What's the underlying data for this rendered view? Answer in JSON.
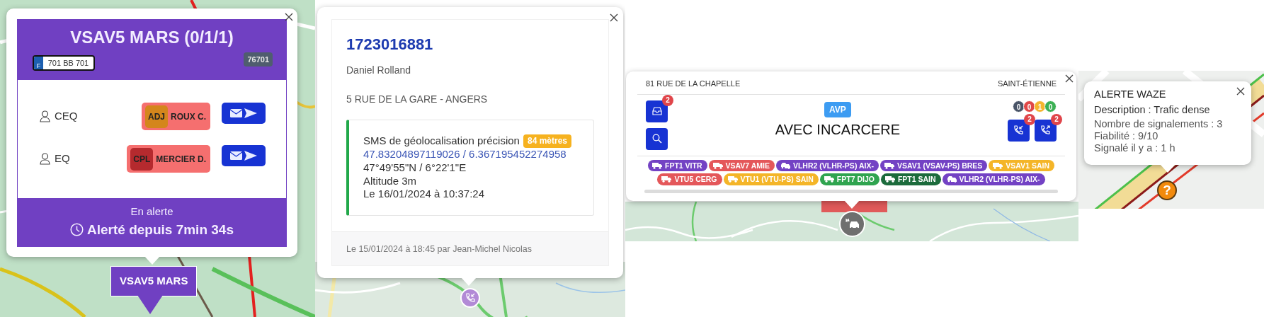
{
  "vehicle_popup": {
    "title": "VSAV5 MARS (0/1/1)",
    "plate_country": "F",
    "plate": "701 BB 701",
    "code": "76701",
    "crew": [
      {
        "role": "CEQ",
        "grade": "ADJ",
        "color": "#d4861c",
        "name": "ROUX C."
      },
      {
        "role": "EQ",
        "grade": "CPL",
        "color": "#b52a2e",
        "name": "MERCIER D."
      }
    ],
    "status": "En alerte",
    "alert_time": "Alerté depuis 7min 34s",
    "marker_label": "VSAV5 MARS"
  },
  "caller_popup": {
    "phone": "1723016881",
    "name": "Daniel Rolland",
    "address": "5 RUE DE LA GARE - ANGERS",
    "geoloc": {
      "label": "SMS de géolocalisation précision",
      "precision": "84 mètres",
      "decimal": "47.83204897119026 / 6.367195452274958",
      "dms": "47°49'55\"N / 6°22'1\"E",
      "altitude": "Altitude 3m",
      "date": "Le 16/01/2024 à 10:37:24"
    },
    "footer": "Le 15/01/2024 à 18:45 par Jean-Michel Nicolas"
  },
  "incident_popup": {
    "address": "81 RUE DE LA CHAPELLE",
    "city": "SAINT-ÉTIENNE",
    "left_buttons": [
      {
        "kind": "inbox",
        "badge": "2"
      },
      {
        "kind": "search"
      }
    ],
    "code": "AVP",
    "title": "AVEC INCARCERE",
    "counters": [
      {
        "value": "0",
        "color": "#4a5568"
      },
      {
        "value": "0",
        "color": "#e04848"
      },
      {
        "value": "1",
        "color": "#f5b52e"
      },
      {
        "value": "0",
        "color": "#3cb054"
      }
    ],
    "call_buttons": [
      {
        "kind": "incoming",
        "badge": "2"
      },
      {
        "kind": "outgoing",
        "badge": "2"
      }
    ],
    "units": [
      {
        "label": "FPT1 VITR",
        "kind": "truck",
        "color": "#7342c4"
      },
      {
        "label": "VSAV7 AMIE",
        "kind": "truck",
        "color": "#e4575a"
      },
      {
        "label": "VLHR2 (VLHR-PS) AIX-",
        "kind": "car",
        "color": "#7342c4"
      },
      {
        "label": "VSAV1 (VSAV-PS) BRES",
        "kind": "truck",
        "color": "#7342c4"
      },
      {
        "label": "VSAV1 SAIN",
        "kind": "truck",
        "color": "#f4b528"
      },
      {
        "label": "VTU5 CERG",
        "kind": "truck",
        "color": "#e4575a"
      },
      {
        "label": "VTU1 (VTU-PS) SAIN",
        "kind": "truck",
        "color": "#f4b528"
      },
      {
        "label": "FPT7 DIJO",
        "kind": "truck",
        "color": "#2fa44f"
      },
      {
        "label": "FPT1 SAIN",
        "kind": "truck",
        "color": "#1c6b3c"
      },
      {
        "label": "VLHR2 (VLHR-PS) AIX-",
        "kind": "car",
        "color": "#7342c4"
      }
    ]
  },
  "waze_popup": {
    "title": "ALERTE WAZE",
    "description": "Description : Trafic dense",
    "lines": [
      "Nombre de signalements : 3",
      "Fiabilité : 9/10",
      "Signalé il y a : 1 h"
    ],
    "marker_symbol": "?"
  }
}
